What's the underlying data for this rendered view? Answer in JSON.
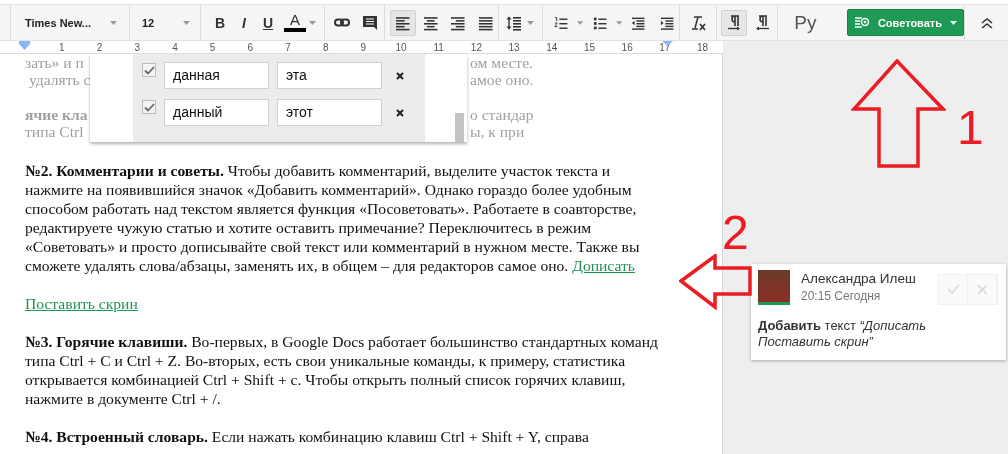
{
  "toolbar": {
    "font": "Times New...",
    "font_size": "12",
    "format_buttons": [
      {
        "kind": "bold",
        "label": "B"
      },
      {
        "kind": "italic",
        "label": "I"
      },
      {
        "kind": "underline",
        "label": "U"
      },
      {
        "kind": "text-color",
        "label": "A"
      }
    ],
    "alignment": [
      {
        "kind": "left",
        "selected": true
      },
      {
        "kind": "center",
        "selected": false
      },
      {
        "kind": "right",
        "selected": false
      },
      {
        "kind": "justify",
        "selected": false
      }
    ],
    "direction": [
      {
        "kind": "ltr",
        "selected": true
      },
      {
        "kind": "rtl",
        "selected": false
      }
    ],
    "language": "Ру",
    "mode_button": "Советовать"
  },
  "ruler": {
    "ticks": [
      "1",
      "2",
      "3",
      "4",
      "5",
      "6",
      "7",
      "8",
      "9",
      "10",
      "11",
      "12",
      "13",
      "14",
      "15",
      "16",
      "17",
      "18"
    ]
  },
  "document": {
    "background_lines": [
      {
        "left": "зать» и п",
        "right": "ом месте.",
        "bold": false
      },
      {
        "left": " удалять с",
        "right": "амое оно.",
        "bold": false
      },
      {
        "left": "ячие кла",
        "right": "о стандар",
        "bold": true
      },
      {
        "left": "типа Ctrl",
        "right": "ы, к при",
        "bold": false
      }
    ],
    "dictionary_popup": {
      "rows": [
        {
          "checked": true,
          "word": "данная",
          "replacement": "эта"
        },
        {
          "checked": true,
          "word": "данный",
          "replacement": "этот"
        }
      ]
    },
    "paragraphs": [
      {
        "kind": "text",
        "text": "**№2. Комментарии и советы.** Чтобы добавить комментарий, выделите участок текста и нажмите на появившийся значок «Добавить комментарий». Однако гораздо более удобным способом работать над текстом является функция «Посоветовать». Работаете в соавторстве, редактируете чужую статью и хотите оставить примечание? Переключитесь в режим «Советовать» и просто дописывайте свой текст или комментарий в нужном месте. Также вы сможете удалять слова/абзацы, заменять их, в общем – для редакторов самое оно.",
        "suggestion": "Дописать"
      },
      {
        "kind": "suggestion",
        "text": "Поставить скрин"
      },
      {
        "kind": "text",
        "text": "**№3. Горячие клавиши.** Во-первых, в Google Docs работает большинство стандартных команд типа Ctrl + C и Ctrl + Z. Во-вторых, есть свои уникальные команды, к примеру, статистика открывается комбинацией Ctrl + Shift + c. Чтобы открыть полный список горячих клавиш, нажмите в документе Ctrl + /."
      },
      {
        "kind": "text",
        "text": "**№4. Встроенный словарь.** Если нажать комбинацию клавиш Ctrl + Shift + Y, справа"
      }
    ]
  },
  "comment": {
    "author": "Александра Илеш",
    "time": "20:15 Сегодня",
    "text": "**Добавить** текст *“Дописать Поставить скрин”*",
    "actions": [
      {
        "kind": "accept",
        "disabled": true
      },
      {
        "kind": "reject",
        "disabled": true
      }
    ]
  },
  "annotations": [
    {
      "kind": "up-arrow",
      "label": "1"
    },
    {
      "kind": "left-arrow",
      "label": "2"
    }
  ]
}
